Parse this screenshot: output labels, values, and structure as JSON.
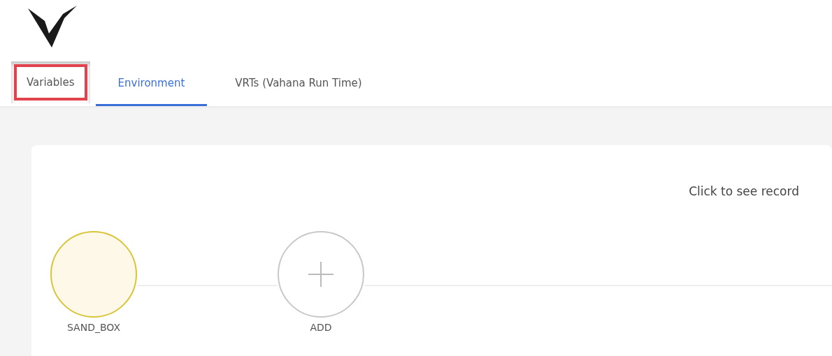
{
  "tabs": [
    {
      "label": "Variables",
      "selected": false,
      "highlighted": true
    },
    {
      "label": "Environment",
      "selected": true,
      "highlighted": false
    },
    {
      "label": "VRTs (Vahana Run Time)",
      "selected": false,
      "highlighted": false
    }
  ],
  "card": {
    "hint": "Click to see record",
    "nodes": [
      {
        "kind": "stage",
        "label": "SAND_BOX"
      },
      {
        "kind": "add",
        "label": "ADD"
      }
    ]
  }
}
